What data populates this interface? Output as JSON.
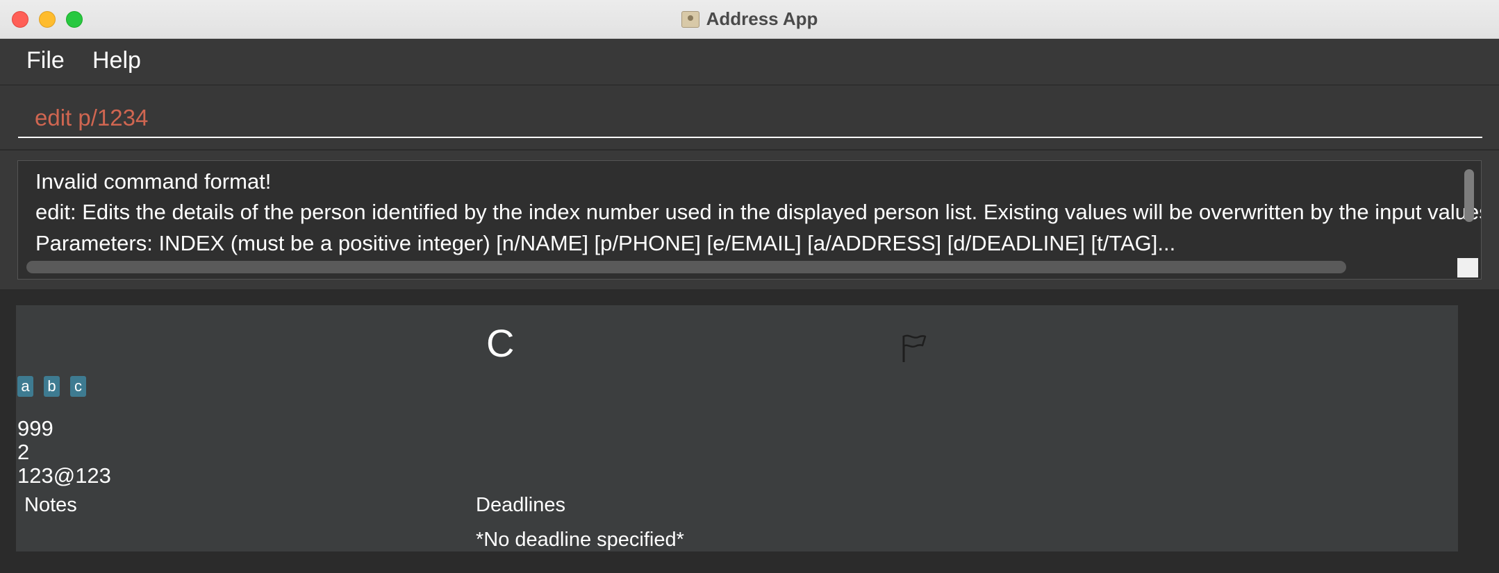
{
  "window": {
    "title": "Address App"
  },
  "menu": {
    "file_label": "File",
    "help_label": "Help"
  },
  "command_box": {
    "value": "edit p/1234",
    "text_color": "#d06651"
  },
  "result_display": {
    "lines": [
      "Invalid command format!",
      "edit: Edits the details of the person identified by the index number used in the displayed person list. Existing values will be overwritten by the input values.",
      "Parameters: INDEX (must be a positive integer) [n/NAME] [p/PHONE] [e/EMAIL] [a/ADDRESS] [d/DEADLINE] [t/TAG]..."
    ]
  },
  "person_card": {
    "name": "C",
    "flag_icon": "flag-icon",
    "tags": [
      "a",
      "b",
      "c"
    ],
    "tag_color": "#3e7b91",
    "phone": "999",
    "address": "2",
    "email": "123@123",
    "notes_label": "Notes",
    "deadlines_label": "Deadlines",
    "deadline_value": "*No deadline specified*"
  }
}
